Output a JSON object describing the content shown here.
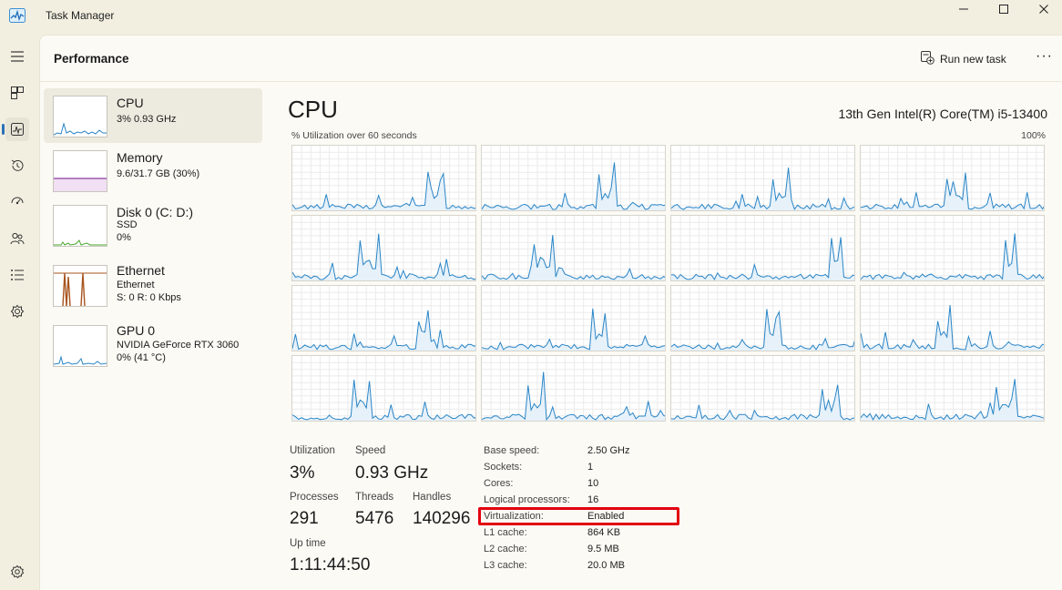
{
  "window": {
    "title": "Task Manager"
  },
  "header": {
    "page_title": "Performance",
    "run_task_label": "Run new task",
    "more_label": "···"
  },
  "nav": {
    "items": [
      "menu-icon",
      "processes-icon",
      "performance-icon",
      "app-history-icon",
      "startup-apps-icon",
      "users-icon",
      "details-icon",
      "services-icon",
      "settings-icon"
    ]
  },
  "resources": [
    {
      "name": "CPU",
      "line1": "3%  0.93 GHz",
      "line2": ""
    },
    {
      "name": "Memory",
      "line1": "9.6/31.7 GB (30%)",
      "line2": ""
    },
    {
      "name": "Disk 0 (C: D:)",
      "line1": "SSD",
      "line2": "0%"
    },
    {
      "name": "Ethernet",
      "line1": "Ethernet",
      "line2": "S: 0  R: 0 Kbps"
    },
    {
      "name": "GPU 0",
      "line1": "NVIDIA GeForce RTX 3060",
      "line2": "0%  (41 °C)"
    }
  ],
  "cpu": {
    "title": "CPU",
    "model": "13th Gen Intel(R) Core(TM) i5-13400",
    "util_label": "% Utilization over 60 seconds",
    "util_max": "100%",
    "stats": {
      "utilization_label": "Utilization",
      "utilization": "3%",
      "speed_label": "Speed",
      "speed": "0.93 GHz",
      "processes_label": "Processes",
      "processes": "291",
      "threads_label": "Threads",
      "threads": "5476",
      "handles_label": "Handles",
      "handles": "140296",
      "uptime_label": "Up time",
      "uptime": "1:11:44:50"
    },
    "specs": [
      {
        "label": "Base speed:",
        "value": "2.50 GHz"
      },
      {
        "label": "Sockets:",
        "value": "1"
      },
      {
        "label": "Cores:",
        "value": "10"
      },
      {
        "label": "Logical processors:",
        "value": "16"
      },
      {
        "label": "Virtualization:",
        "value": "Enabled"
      },
      {
        "label": "L1 cache:",
        "value": "864 KB"
      },
      {
        "label": "L2 cache:",
        "value": "9.5 MB"
      },
      {
        "label": "L3 cache:",
        "value": "20.0 MB"
      }
    ]
  },
  "colors": {
    "cpu_line": "#2a85c6",
    "memory_line": "#8b3a9c",
    "disk_line": "#4aa52a",
    "ethernet_line": "#a7541e",
    "highlight": "#e3000f"
  }
}
